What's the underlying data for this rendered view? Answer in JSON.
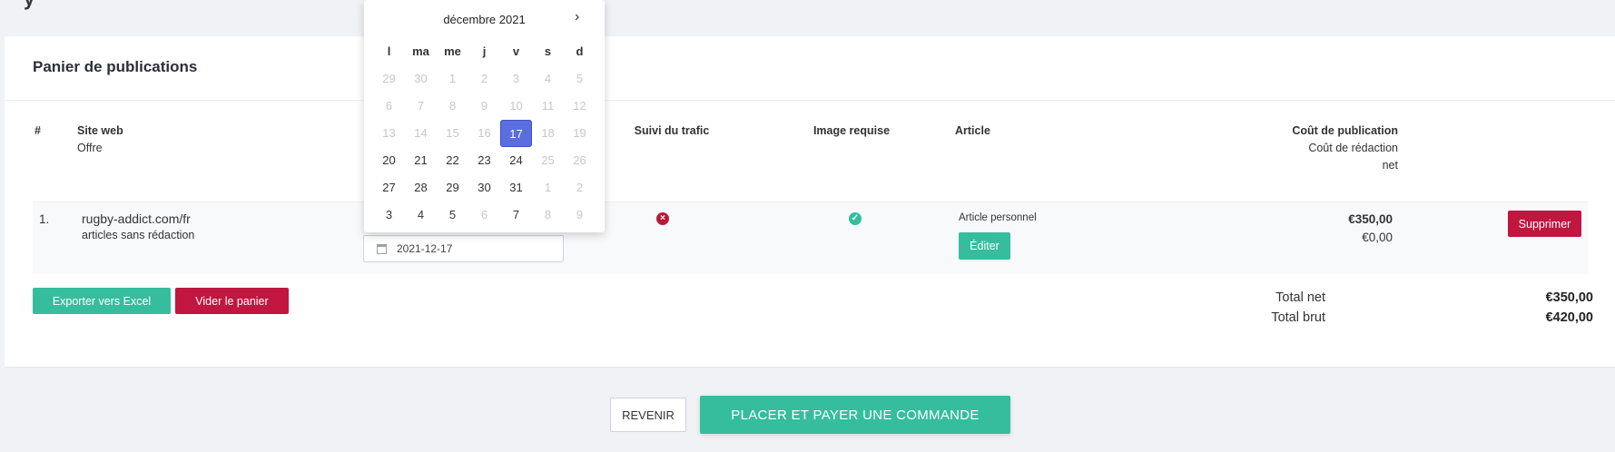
{
  "card": {
    "title": "Panier de publications"
  },
  "table": {
    "col_index": "#",
    "col_site": "Site web",
    "col_site_sub": "Offre",
    "col_traffic": "Suivi du trafic",
    "col_image": "Image requise",
    "col_article": "Article",
    "col_cost": "Coût de publication",
    "col_cost_sub1": "Coût de rédaction",
    "col_cost_sub2": "net"
  },
  "row": {
    "index": "1.",
    "site": "rugby-addict.com/fr",
    "offer": "articles sans rédaction",
    "date": "2021-12-17",
    "traffic_icon": "error-icon",
    "image_icon": "check-icon",
    "article_type": "Article personnel",
    "edit_label": "Éditer",
    "publication_cost": "€350,00",
    "writing_cost": "€0,00",
    "delete_label": "Supprimer"
  },
  "actions": {
    "export_label": "Exporter vers Excel",
    "empty_label": "Vider le panier"
  },
  "totals": {
    "net_label": "Total net",
    "net_value": "€350,00",
    "gross_label": "Total brut",
    "gross_value": "€420,00"
  },
  "footer": {
    "back_label": "REVENIR",
    "order_label": "PLACER ET PAYER UNE COMMANDE"
  },
  "datepicker": {
    "month": "décembre 2021",
    "next_icon": "chevron-right-icon",
    "weekdays": [
      "l",
      "ma",
      "me",
      "j",
      "v",
      "s",
      "d"
    ],
    "weeks": [
      [
        [
          "29",
          "m"
        ],
        [
          "30",
          "m"
        ],
        [
          "1",
          "m"
        ],
        [
          "2",
          "m"
        ],
        [
          "3",
          "m"
        ],
        [
          "4",
          "m"
        ],
        [
          "5",
          "m"
        ]
      ],
      [
        [
          "6",
          "m"
        ],
        [
          "7",
          "m"
        ],
        [
          "8",
          "m"
        ],
        [
          "9",
          "m"
        ],
        [
          "10",
          "m"
        ],
        [
          "11",
          "m"
        ],
        [
          "12",
          "m"
        ]
      ],
      [
        [
          "13",
          "m"
        ],
        [
          "14",
          "m"
        ],
        [
          "15",
          "m"
        ],
        [
          "16",
          "m"
        ],
        [
          "17",
          "s"
        ],
        [
          "18",
          "m"
        ],
        [
          "19",
          "m"
        ]
      ],
      [
        [
          "20",
          ""
        ],
        [
          "21",
          ""
        ],
        [
          "22",
          ""
        ],
        [
          "23",
          ""
        ],
        [
          "24",
          ""
        ],
        [
          "25",
          "m"
        ],
        [
          "26",
          "m"
        ]
      ],
      [
        [
          "27",
          ""
        ],
        [
          "28",
          ""
        ],
        [
          "29",
          ""
        ],
        [
          "30",
          ""
        ],
        [
          "31",
          ""
        ],
        [
          "1",
          "m"
        ],
        [
          "2",
          "m"
        ]
      ],
      [
        [
          "3",
          ""
        ],
        [
          "4",
          ""
        ],
        [
          "5",
          ""
        ],
        [
          "6",
          "m"
        ],
        [
          "7",
          ""
        ],
        [
          "8",
          "m"
        ],
        [
          "9",
          "m"
        ]
      ]
    ],
    "selected": "17"
  },
  "colors": {
    "teal": "#35bd9d",
    "red": "#c0163f",
    "selected": "#5b6ee1"
  }
}
